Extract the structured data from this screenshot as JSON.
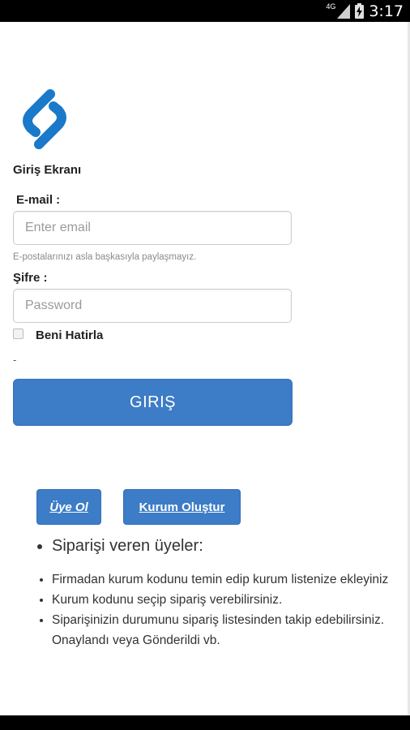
{
  "status_bar": {
    "network": "4G",
    "time": "3:17"
  },
  "login": {
    "title": "Giriş Ekranı",
    "email_label": "E-mail :",
    "email_placeholder": "Enter email",
    "email_help": "E-postalarınızı asla başkasıyla paylaşmayız.",
    "password_label": "Şifre :",
    "password_placeholder": "Password",
    "remember_label": "Beni Hatirla",
    "dash": "-",
    "submit_label": "GIRIŞ"
  },
  "actions": {
    "register_label": "Üye Ol",
    "create_org_label": "Kurum Oluştur"
  },
  "info": {
    "heading": "Siparişi veren üyeler:",
    "items": [
      "Firmadan kurum kodunu temin edip kurum listenize ekleyiniz",
      "Kurum kodunu seçip sipariş verebilirsiniz.",
      "Siparişinizin durumunu sipariş listesinden takip edebilirsiniz. Onaylandı veya Gönderildi vb."
    ]
  },
  "colors": {
    "primary": "#3d7cc6",
    "logo": "#1a79c9",
    "statusbar": "#000000"
  },
  "icons": [
    "signal-icon",
    "battery-icon",
    "app-logo-icon"
  ]
}
